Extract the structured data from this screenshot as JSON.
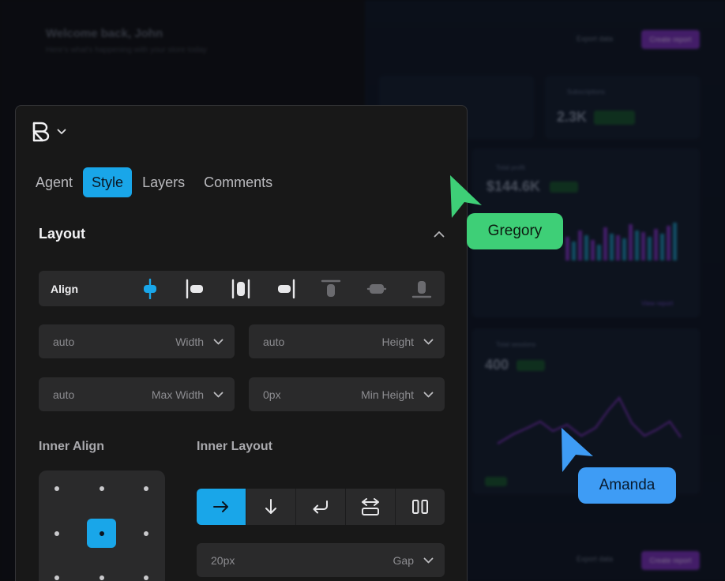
{
  "background": {
    "greeting": "Welcome back, John",
    "subtitle": "Here's what's happening with your store today",
    "export_label": "Export data",
    "cta_label": "Create report",
    "cards": [
      {
        "label": "Subscriptions",
        "value": "2.3K"
      },
      {
        "label": "Total profit",
        "value": "$144.6K"
      },
      {
        "label": "Total sessions",
        "value": "400"
      }
    ]
  },
  "panel": {
    "tabs": [
      {
        "label": "Agent",
        "active": false
      },
      {
        "label": "Style",
        "active": true
      },
      {
        "label": "Layers",
        "active": false
      },
      {
        "label": "Comments",
        "active": false
      }
    ],
    "section_title": "Layout",
    "align": {
      "label": "Align",
      "icons": [
        "align-center-h-icon",
        "align-left-icon",
        "align-space-between-icon",
        "align-right-icon",
        "align-top-icon",
        "align-center-v-icon",
        "align-bottom-icon"
      ],
      "active_index": 0
    },
    "fields": {
      "width": {
        "value": "auto",
        "label": "Width"
      },
      "height": {
        "value": "auto",
        "label": "Height"
      },
      "max_width": {
        "value": "auto",
        "label": "Max Width"
      },
      "min_height": {
        "value": "0px",
        "label": "Min Height"
      },
      "gap": {
        "value": "20px",
        "label": "Gap"
      }
    },
    "inner_align": {
      "title": "Inner Align",
      "selected": "center"
    },
    "inner_layout": {
      "title": "Inner Layout",
      "options": [
        "arrow-right-icon",
        "arrow-down-icon",
        "wrap-icon",
        "space-between-icon",
        "columns-icon"
      ],
      "active_index": 0
    }
  },
  "collaborators": [
    {
      "name": "Gregory",
      "color": "#3ecf77"
    },
    {
      "name": "Amanda",
      "color": "#3e9cf5"
    }
  ],
  "colors": {
    "accent": "#19a6e9",
    "panel_bg": "#181818",
    "field_bg": "#2a2a2b"
  }
}
